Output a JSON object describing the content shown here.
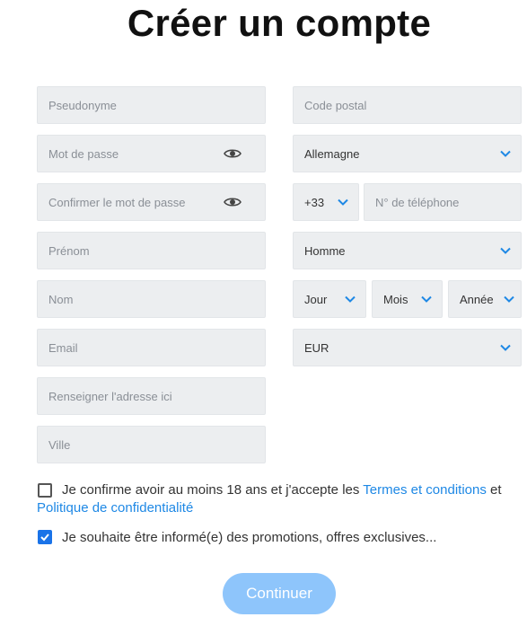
{
  "title": "Créer un compte",
  "left_fields": {
    "pseudonyme": "Pseudonyme",
    "password": "Mot de passe",
    "confirm_password": "Confirmer le mot de passe",
    "prenom": "Prénom",
    "nom": "Nom",
    "email": "Email",
    "address": "Renseigner l'adresse ici",
    "ville": "Ville"
  },
  "right_fields": {
    "postal_code": "Code postal",
    "country": "Allemagne",
    "phone_prefix": "+33",
    "phone": "N° de téléphone",
    "gender": "Homme",
    "day": "Jour",
    "month": "Mois",
    "year": "Année",
    "currency": "EUR"
  },
  "consent": {
    "terms_prefix": "Je confirme avoir au moins 18 ans et j'accepte les",
    "terms_link": "Termes et conditions",
    "and_text": "et",
    "privacy_link": "Politique de confidentialité",
    "terms_checked": false,
    "promo_text": "Je souhaite être informé(e) des promotions, offres exclusives...",
    "promo_checked": true
  },
  "submit_label": "Continuer",
  "colors": {
    "accent": "#1e88e5",
    "field_bg": "#eceef0",
    "button_bg": "#8ec5fb"
  }
}
